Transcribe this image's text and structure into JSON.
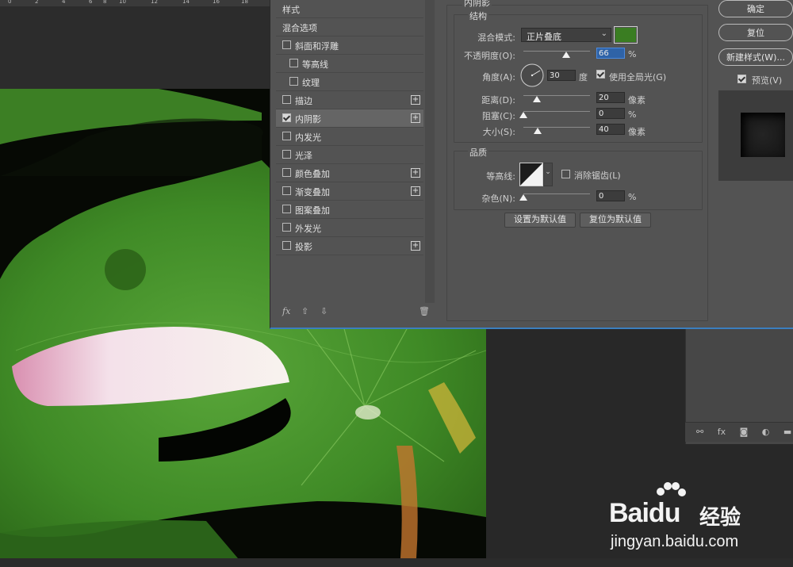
{
  "ruler": {
    "ticks": [
      "0",
      "2",
      "4",
      "6",
      "8",
      "10",
      "12",
      "14",
      "16",
      "18"
    ]
  },
  "dialog": {
    "section_title": "内阴影",
    "structure_title": "结构",
    "blend_mode_label": "混合模式:",
    "blend_mode_value": "正片叠底",
    "blend_color": "#3a7d22",
    "opacity_label": "不透明度(O):",
    "opacity_value": "66",
    "opacity_unit": "%",
    "angle_label": "角度(A):",
    "angle_value": "30",
    "angle_unit": "度",
    "global_light_label": "使用全局光(G)",
    "distance_label": "距离(D):",
    "distance_value": "20",
    "distance_unit": "像素",
    "choke_label": "阻塞(C):",
    "choke_value": "0",
    "choke_unit": "%",
    "size_label": "大小(S):",
    "size_value": "40",
    "size_unit": "像素",
    "quality_title": "品质",
    "contour_label": "等高线:",
    "antialias_label": "消除锯齿(L)",
    "noise_label": "杂色(N):",
    "noise_value": "0",
    "noise_unit": "%",
    "set_default": "设置为默认值",
    "reset_default": "复位为默认值",
    "ok": "确定",
    "reset": "复位",
    "new_style": "新建样式(W)...",
    "preview": "预览(V)"
  },
  "styles_list": {
    "header": "样式",
    "blend_options": "混合选项",
    "items": [
      {
        "label": "斜面和浮雕",
        "checked": false,
        "plus": false,
        "indent": 0
      },
      {
        "label": "等高线",
        "checked": false,
        "plus": false,
        "indent": 1
      },
      {
        "label": "纹理",
        "checked": false,
        "plus": false,
        "indent": 1
      },
      {
        "label": "描边",
        "checked": false,
        "plus": true,
        "indent": 0
      },
      {
        "label": "内阴影",
        "checked": true,
        "plus": true,
        "indent": 0
      },
      {
        "label": "内发光",
        "checked": false,
        "plus": false,
        "indent": 0
      },
      {
        "label": "光泽",
        "checked": false,
        "plus": false,
        "indent": 0
      },
      {
        "label": "颜色叠加",
        "checked": false,
        "plus": true,
        "indent": 0
      },
      {
        "label": "渐变叠加",
        "checked": false,
        "plus": true,
        "indent": 0
      },
      {
        "label": "图案叠加",
        "checked": false,
        "plus": false,
        "indent": 0
      },
      {
        "label": "外发光",
        "checked": false,
        "plus": false,
        "indent": 0
      },
      {
        "label": "投影",
        "checked": false,
        "plus": true,
        "indent": 0
      }
    ],
    "footer_fx": "fx"
  },
  "watermark": {
    "brand": "Bai",
    "brand2": "du",
    "cn": "经验",
    "url": "jingyan.baidu.com"
  }
}
